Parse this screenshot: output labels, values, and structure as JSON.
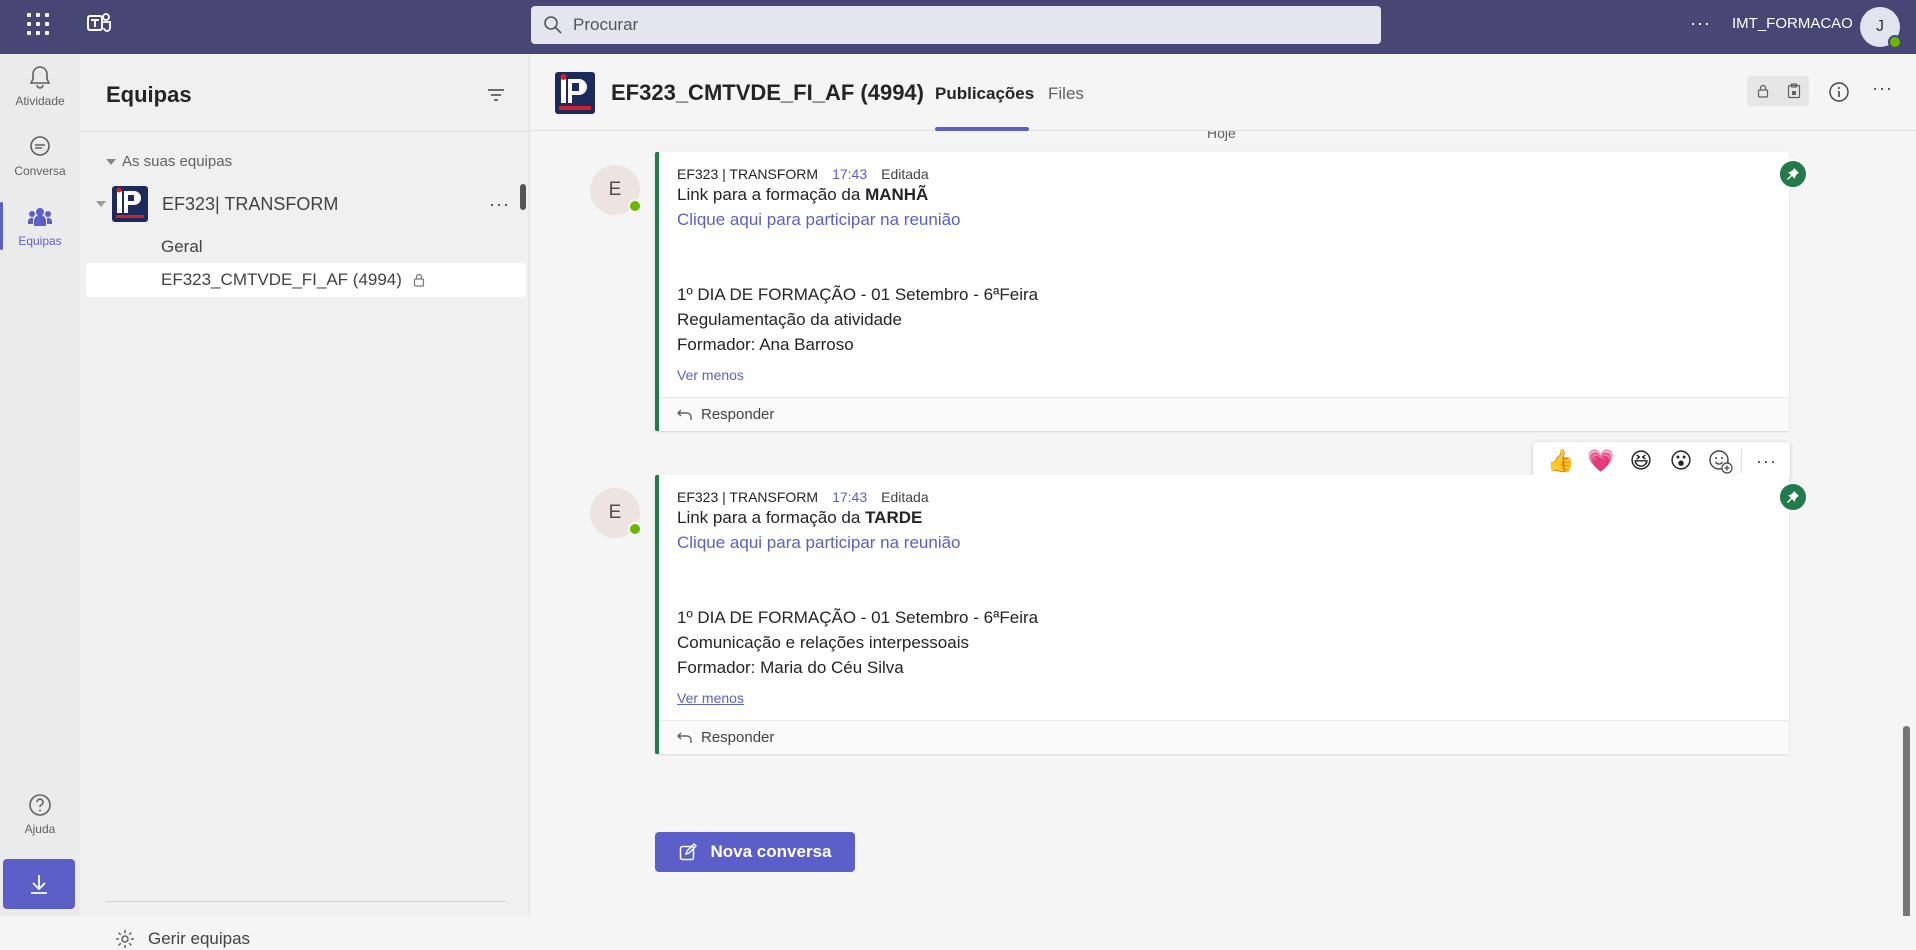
{
  "topbar": {
    "search_placeholder": "Procurar",
    "more_label": "···",
    "user_name": "IMT_FORMACAO",
    "avatar_initial": "J"
  },
  "rail": {
    "items": [
      {
        "label": "Atividade",
        "icon": "bell-icon"
      },
      {
        "label": "Conversa",
        "icon": "chat-icon"
      },
      {
        "label": "Equipas",
        "icon": "teams-icon"
      },
      {
        "label": "Ajuda",
        "icon": "help-icon"
      }
    ],
    "download_icon": "download-icon"
  },
  "teams_panel": {
    "title": "Equipas",
    "section_label": "As suas equipas",
    "team_name": "EF323| TRANSFORM",
    "team_more": "···",
    "channels": [
      {
        "label": "Geral"
      },
      {
        "label": "EF323_CMTVDE_FI_AF (4994)"
      }
    ],
    "manage_label": "Gerir equipas"
  },
  "channel_header": {
    "title": "EF323_CMTVDE_FI_AF (4994)",
    "tabs": [
      {
        "label": "Publicações"
      },
      {
        "label": "Files"
      }
    ],
    "more_label": "···"
  },
  "main": {
    "date_divider": "Hoje",
    "messages": [
      {
        "avatar_initial": "E",
        "author": "EF323 | TRANSFORM",
        "time": "17:43",
        "edited": "Editada",
        "line1_prefix": "Link para a formação da ",
        "line1_bold": "MANHÃ",
        "link": "Clique aqui para participar na reunião",
        "day_line": "1º DIA DE FORMAÇÃO - 01 Setembro -  6ªFeira",
        "topic": "Regulamentação da atividade",
        "trainer": "Formador: Ana Barroso",
        "see_less": "Ver menos",
        "reply": "Responder"
      },
      {
        "avatar_initial": "E",
        "author": "EF323 | TRANSFORM",
        "time": "17:43",
        "edited": "Editada",
        "line1_prefix": "Link para a formação da ",
        "line1_bold": "TARDE",
        "link": "Clique aqui para participar na reunião",
        "day_line": "1º DIA DE FORMAÇÃO - 01 Setembro -  6ªFeira",
        "topic": "Comunicação e relações interpessoais",
        "trainer": "Formador: Maria do Céu Silva",
        "see_less": "Ver menos",
        "reply": "Responder"
      }
    ],
    "reactions": [
      "👍",
      "💗",
      "😆",
      "😮"
    ],
    "reaction_more": "···",
    "new_conversation": "Nova conversa"
  },
  "colors": {
    "brand": "#464775",
    "accent": "#5b5fc7",
    "pin_green": "#237b4b",
    "presence": "#6bb700"
  }
}
